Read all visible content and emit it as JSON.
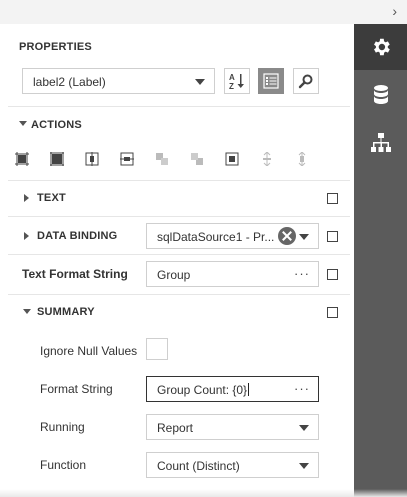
{
  "header": {
    "title": "PROPERTIES"
  },
  "selector": {
    "value": "label2 (Label)"
  },
  "sections": {
    "actions": "ACTIONS",
    "text": "TEXT",
    "data_binding": "DATA BINDING",
    "text_format_string": "Text Format String",
    "summary": "SUMMARY"
  },
  "data_binding": {
    "value": "sqlDataSource1 - Pr..."
  },
  "text_format": {
    "value": "Group"
  },
  "summary": {
    "ignore_null_label": "Ignore Null Values",
    "format_string_label": "Format String",
    "format_string_value": "Group Count: {0}",
    "running_label": "Running",
    "running_value": "Report",
    "function_label": "Function",
    "function_value": "Count (Distinct)"
  },
  "icons": {
    "sidebar": [
      "gear-icon",
      "database-icon",
      "hierarchy-icon"
    ],
    "toolbar": [
      "sort-az-icon",
      "categories-icon",
      "search-icon"
    ],
    "actions": [
      "align-to-grid-icon",
      "size-to-grid-icon",
      "center-horizontally-icon",
      "center-vertically-icon",
      "bring-to-front-icon",
      "send-to-back-icon",
      "fit-bounds-icon",
      "vertical-space-icon",
      "horizontal-space-icon"
    ]
  },
  "colors": {
    "sidebar_bg": "#5b5b5b",
    "sidebar_active": "#3c3c3c",
    "active_toggle": "#8a8a8a"
  }
}
